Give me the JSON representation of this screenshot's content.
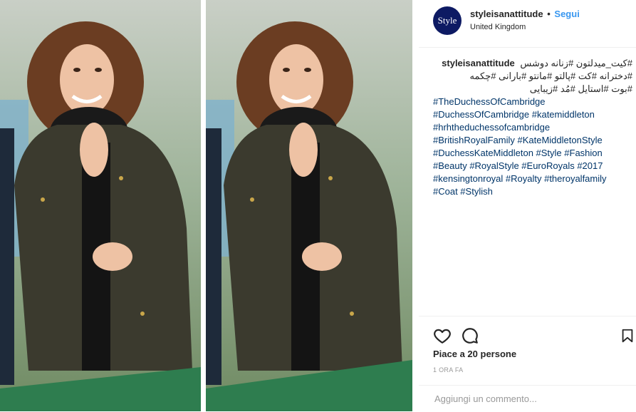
{
  "post": {
    "avatar_text": "Style",
    "username": "styleisanattitude",
    "separator": "•",
    "follow_label": "Segui",
    "location": "United Kingdom"
  },
  "caption": {
    "username": "styleisanattitude",
    "rtl_lines": [
      "#کیت_میدلتون #زنانه دوشس",
      "#دخترانه #کت #پالتو #مانتو #بارانی #چکمه",
      "#بوت #استایل #مُد #زیبایی"
    ],
    "lines": [
      "#TheDuchessOfCambridge",
      "#DuchessOfCambridge #katemiddleton",
      "#hrhtheduchessofcambridge",
      "#BritishRoyalFamily #KateMiddletonStyle",
      "#DuchessKateMiddleton #Style #Fashion",
      "#Beauty #RoyalStyle #EuroRoyals #2017",
      "#kensingtonroyal #Royalty #theroyalfamily",
      "#Coat #Stylish"
    ]
  },
  "actions": {
    "like_icon": "heart-icon",
    "comment_icon": "speech-bubble-icon",
    "save_icon": "bookmark-icon"
  },
  "likes_text": "Piace a 20 persone",
  "timestamp": "1 ORA FA",
  "comment_box": {
    "placeholder": "Aggiungi un commento..."
  },
  "colors": {
    "avatar_bg": "#0d1a63",
    "follow": "#3897f0",
    "jacket": "#3b3a2e",
    "railing": "#2e7d4f"
  }
}
